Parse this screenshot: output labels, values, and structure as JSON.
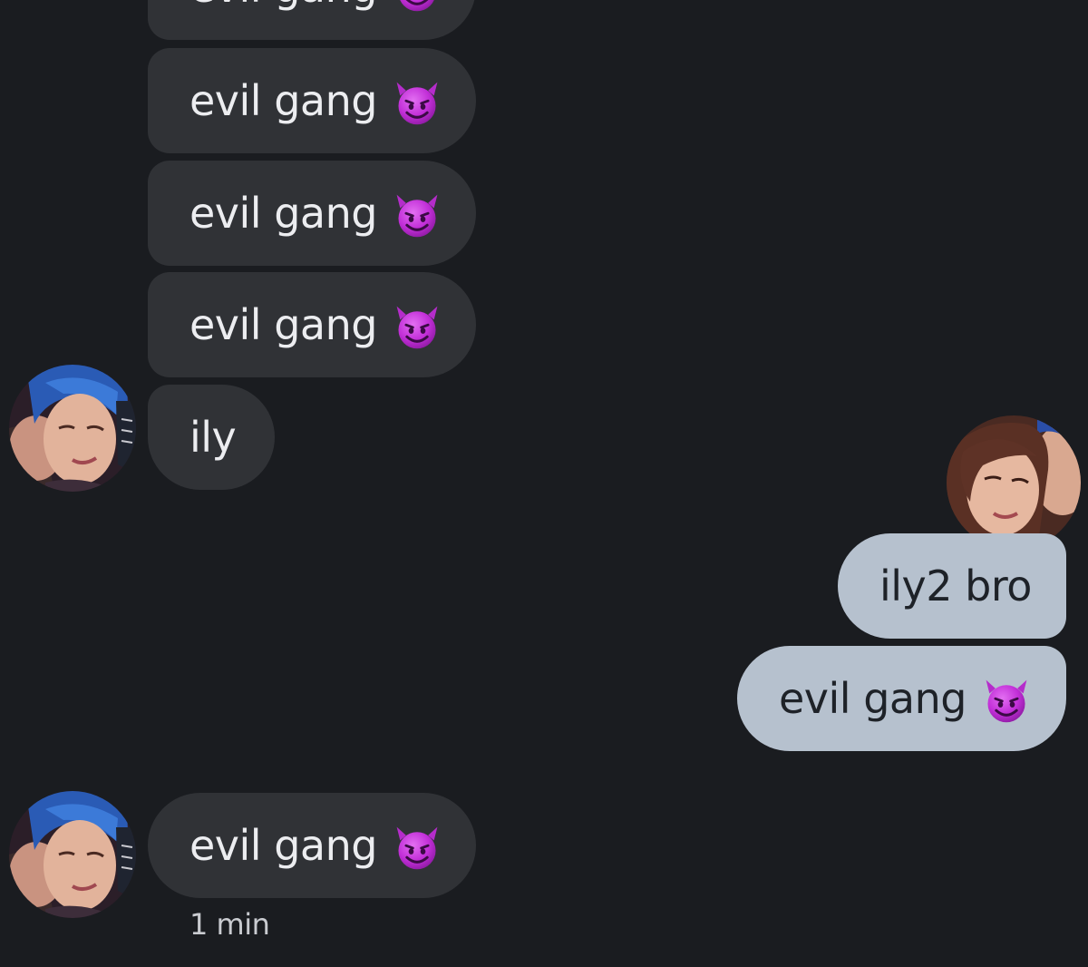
{
  "conversation": {
    "messages": [
      {
        "sender": "them",
        "text": "evil gang",
        "emoji": "smiling-imp-emoji"
      },
      {
        "sender": "them",
        "text": "evil gang",
        "emoji": "smiling-imp-emoji"
      },
      {
        "sender": "them",
        "text": "evil gang",
        "emoji": "smiling-imp-emoji"
      },
      {
        "sender": "them",
        "text": "evil gang",
        "emoji": "smiling-imp-emoji"
      },
      {
        "sender": "them",
        "text": "ily"
      },
      {
        "sender": "me",
        "text": "ily2 bro"
      },
      {
        "sender": "me",
        "text": "evil gang",
        "emoji": "smiling-imp-emoji"
      },
      {
        "sender": "them",
        "text": "evil gang",
        "emoji": "smiling-imp-emoji"
      }
    ],
    "last_timestamp": "1 min"
  },
  "colors": {
    "background": "#1a1c20",
    "incoming_bubble": "#303236",
    "outgoing_bubble": "#b6c1ce",
    "emoji_purple": "#c22fd8"
  }
}
